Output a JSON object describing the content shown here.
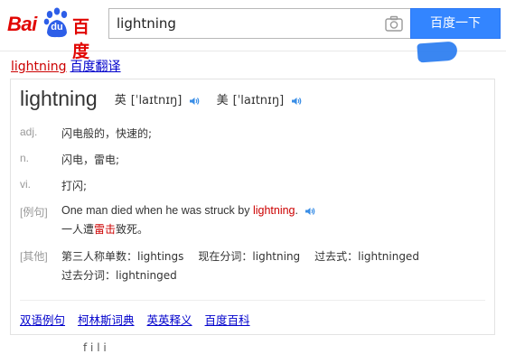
{
  "header": {
    "logo": {
      "en_part": "Bai",
      "paw_text": "du",
      "cn_part": "百度",
      "brand_color": "#e10602"
    },
    "search": {
      "value": "lightning",
      "button_label": "百度一下",
      "button_color": "#3385ff",
      "camera_icon": "camera-icon"
    }
  },
  "result": {
    "title_word": "lightning",
    "title_rest": "百度翻译",
    "link_color": "#0000cc",
    "highlight_color": "#cc0000"
  },
  "card": {
    "headword": "lightning",
    "pron_uk_label": "英",
    "pron_uk": "[ˈlaɪtnɪŋ]",
    "pron_us_label": "美",
    "pron_us": "[ˈlaɪtnɪŋ]",
    "speaker_icon": "speaker-icon",
    "definitions": [
      {
        "pos": "adj.",
        "text": "闪电般的，快速的;"
      },
      {
        "pos": "n.",
        "text": "闪电，雷电;"
      },
      {
        "pos": "vi.",
        "text": "打闪;"
      }
    ],
    "example": {
      "label": "[例句]",
      "en_before": "One man died when he was struck by",
      "en_hl": "lightning",
      "en_after": ".",
      "zh_before": "一人遭",
      "zh_hl": "雷击",
      "zh_after": "致死。"
    },
    "other": {
      "label": "[其他]",
      "items": [
        "第三人称单数：lightings",
        "现在分词：lightning",
        "过去式：lightninged"
      ],
      "line2": "过去分词：lightninged"
    },
    "links": [
      "双语例句",
      "柯林斯词典",
      "英英释义",
      "百度百科"
    ]
  },
  "footer_cut_text": "f   i   l   i"
}
